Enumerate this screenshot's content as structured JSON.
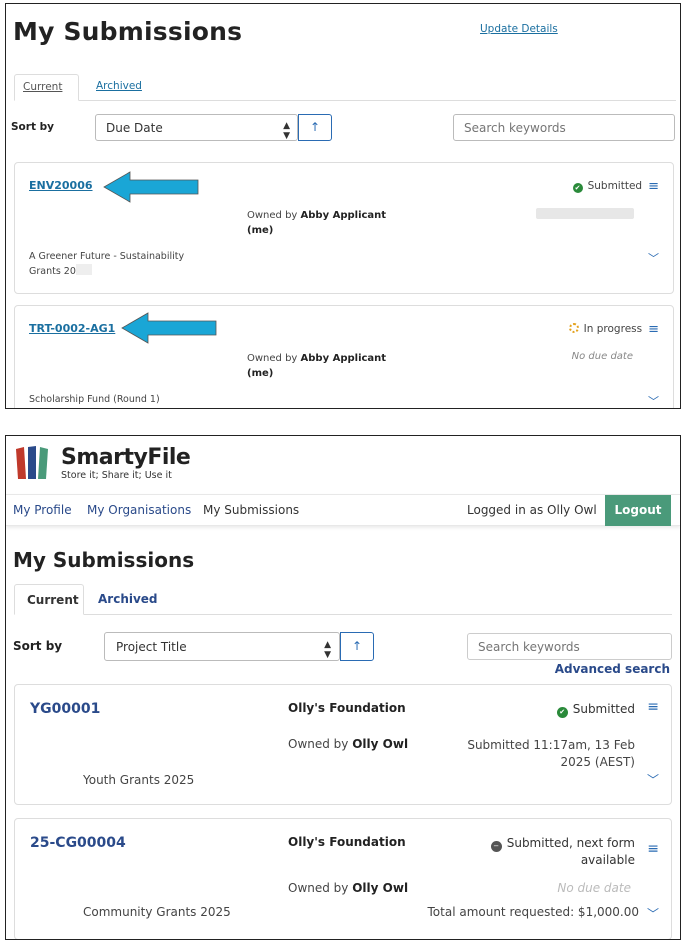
{
  "top_panel": {
    "page_title": "My Submissions",
    "update_details": "Update Details",
    "tabs": [
      {
        "label": "Current"
      },
      {
        "label": "Archived"
      }
    ],
    "sort_by_label": "Sort by",
    "sort_selected": "Due Date",
    "sort_direction_icon": "↑",
    "search_placeholder": "Search keywords",
    "submissions": [
      {
        "ref": "ENV20006",
        "status": "Submitted",
        "owned_prefix": "Owned by",
        "owner": "Abby Applicant",
        "owner_suffix": "(me)",
        "program_line1": "A Greener Future - Sustainability",
        "program_line2": "Grants 20"
      },
      {
        "ref": "TRT-0002-AG1",
        "status": "In progress",
        "owned_prefix": "Owned by",
        "owner": "Abby Applicant",
        "owner_suffix": "(me)",
        "due": "No due date",
        "program": "Scholarship Fund (Round 1)"
      }
    ],
    "arrow_color": "#1aa6d6"
  },
  "bottom_panel": {
    "brand": "SmartyFile",
    "tagline": "Store it; Share it; Use it",
    "nav": [
      "My Profile",
      "My Organisations",
      "My Submissions"
    ],
    "logged_in_as": "Logged in as Olly Owl",
    "logout": "Logout",
    "page_title": "My Submissions",
    "tabs": [
      {
        "label": "Current"
      },
      {
        "label": "Archived"
      }
    ],
    "sort_by_label": "Sort by",
    "sort_selected": "Project Title",
    "sort_direction_icon": "↑",
    "search_placeholder": "Search keywords",
    "advanced_search": "Advanced search",
    "submissions": [
      {
        "ref": "YG00001",
        "organisation": "Olly's Foundation",
        "status": "Submitted",
        "owned_prefix": "Owned by",
        "owner": "Olly Owl",
        "submitted_date": "Submitted 11:17am, 13 Feb 2025 (AEST)",
        "program": "Youth Grants 2025"
      },
      {
        "ref": "25-CG00004",
        "organisation": "Olly's Foundation",
        "status": "Submitted, next form available",
        "owned_prefix": "Owned by",
        "owner": "Olly Owl",
        "due": "No due date",
        "program": "Community Grants 2025",
        "total": "Total amount requested: $1,000.00"
      }
    ],
    "colors": {
      "logo_bars": [
        "#c0392b",
        "#2a4a8a",
        "#4a9a7a"
      ],
      "logout_bg": "#4a9a7a",
      "link": "#2a4a8a"
    }
  }
}
